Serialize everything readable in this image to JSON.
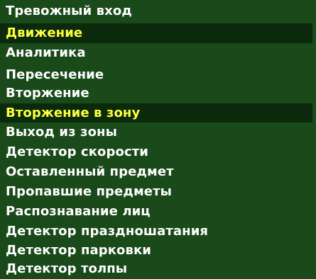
{
  "menu": {
    "top_items": [
      {
        "label": "Тревожный вход",
        "selected": false
      },
      {
        "label": "Движение",
        "selected": true
      },
      {
        "label": "Аналитика",
        "selected": false
      }
    ],
    "sub_items": [
      {
        "label": "Пересечение",
        "selected": false
      },
      {
        "label": "Вторжение",
        "selected": false
      },
      {
        "label": "Вторжение в зону",
        "selected": true
      },
      {
        "label": "Выход из зоны",
        "selected": false
      },
      {
        "label": "Детектор скорости",
        "selected": false
      },
      {
        "label": "Оставленный предмет",
        "selected": false
      },
      {
        "label": "Пропавшие предметы",
        "selected": false
      },
      {
        "label": "Распознавание лиц",
        "selected": false
      },
      {
        "label": "Детектор праздношатания",
        "selected": false
      },
      {
        "label": "Детектор парковки",
        "selected": false
      },
      {
        "label": "Детектор толпы",
        "selected": false
      }
    ]
  },
  "colors": {
    "background": "#1a4a1a",
    "highlight_background": "#0b2a0b",
    "text": "#ffffff",
    "highlight_text": "#ffff40",
    "divider": "#ffffff"
  }
}
